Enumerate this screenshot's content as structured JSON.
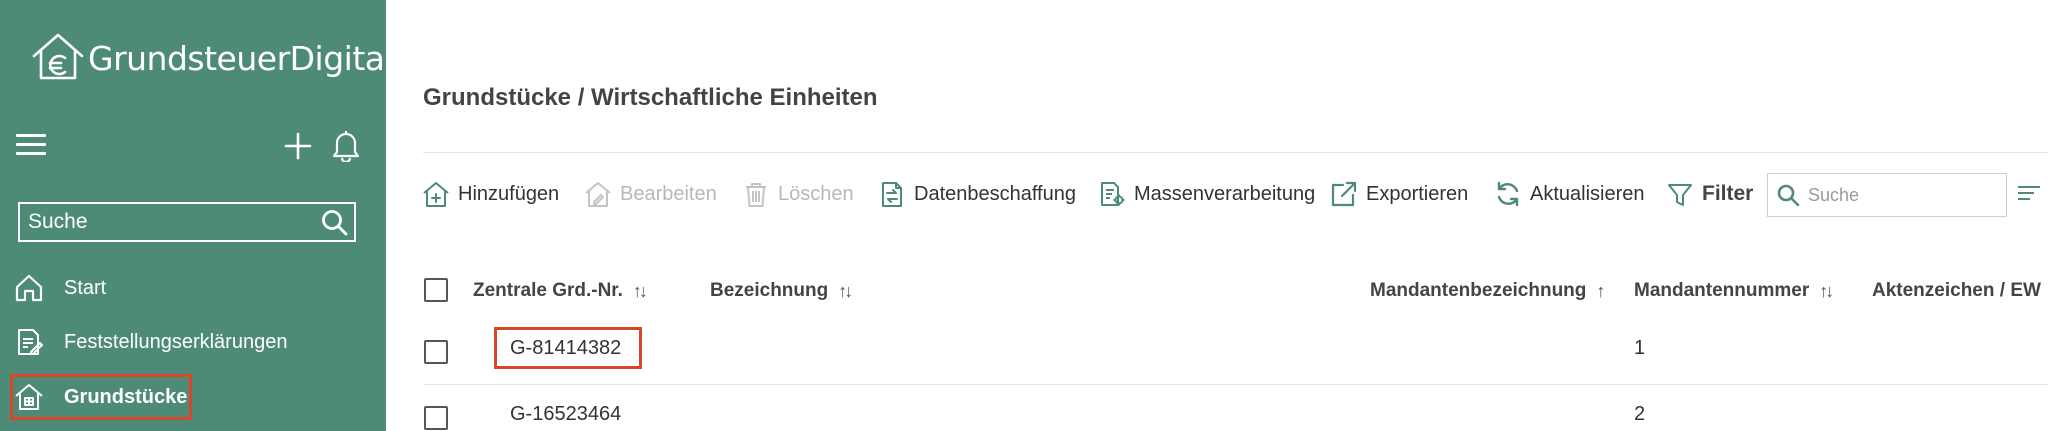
{
  "sidebar": {
    "logo_text": "GrundsteuerDigital",
    "search_placeholder": "Suche",
    "nav": [
      {
        "label": "Start",
        "icon": "home-icon"
      },
      {
        "label": "Feststellungserklärungen",
        "icon": "document-edit-icon"
      },
      {
        "label": "Grundstücke",
        "icon": "property-house-icon",
        "active": true
      }
    ]
  },
  "main": {
    "title": "Grundstücke / Wirtschaftliche Einheiten",
    "toolbar": {
      "add": "Hinzufügen",
      "edit": "Bearbeiten",
      "delete": "Löschen",
      "data_procurement": "Datenbeschaffung",
      "bulk_processing": "Massenverarbeitung",
      "export": "Exportieren",
      "refresh": "Aktualisieren",
      "filter": "Filter",
      "search_placeholder": "Suche"
    },
    "table": {
      "columns": {
        "grd_nr": "Zentrale Grd.-Nr.",
        "bezeichnung": "Bezeichnung",
        "mandantenbezeichnung": "Mandantenbezeichnung",
        "mandantennummer": "Mandantennummer",
        "aktenzeichen": "Aktenzeichen / EW"
      },
      "rows": [
        {
          "grd_nr": "G-81414382",
          "bezeichnung": "",
          "mandantenbezeichnung": "",
          "mandantennummer": "1",
          "aktenzeichen": ""
        },
        {
          "grd_nr": "G-16523464",
          "bezeichnung": "",
          "mandantenbezeichnung": "",
          "mandantennummer": "2",
          "aktenzeichen": ""
        }
      ]
    }
  },
  "colors": {
    "sidebar_bg": "#4d8b77",
    "highlight": "#d9472b",
    "icon_green": "#4d8b77"
  }
}
